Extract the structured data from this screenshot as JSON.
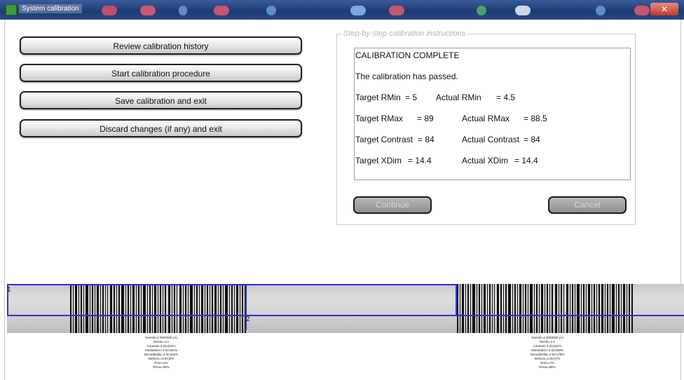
{
  "window": {
    "title": "System calibration",
    "close_glyph": "✕"
  },
  "buttons": [
    {
      "label": "Review calibration history"
    },
    {
      "label": "Start calibration procedure"
    },
    {
      "label": "Save calibration and exit"
    },
    {
      "label": "Discard changes (if any) and exit"
    }
  ],
  "instructions": {
    "group_label": "Step-by-step calibration instructions",
    "heading": "CALIBRATION COMPLETE",
    "status": "The calibration has passed.",
    "rmin": {
      "target_label": "Target RMin",
      "target_value": "= 5",
      "actual_label": "Actual RMin",
      "actual_value": "= 4.5"
    },
    "rmax": {
      "target_label": "Target RMax",
      "target_value": "= 89",
      "actual_label": "Actual RMax",
      "actual_value": "= 88.5"
    },
    "contrast": {
      "target_label": "Target Contrast",
      "target_value": "= 84",
      "actual_label": "Actual Contrast",
      "actual_value": "= 84"
    },
    "xdim": {
      "target_label": "Target XDim",
      "target_value": "= 14.4",
      "actual_label": "Actual XDim",
      "actual_value": "= 14.4"
    },
    "continue_label": "Continue",
    "cancel_label": "Cancel"
  },
  "scan": {
    "marker1": "1",
    "marker2": "2",
    "left_stats": [
      "Overall=4.0000000 (A)",
      "EDGE=4.4",
      "Contrast=4.0(A)84%",
      "Modulation=4.0(A)91%",
      "Decodability=4.0(A)91%",
      "Defects=4.0(A)8%",
      "Rmin=5%",
      "Rmax=89%"
    ],
    "right_stats": [
      "Overall=4.0000000 (A)",
      "EDGE=4.4",
      "Contrast=4.0(A)84%",
      "Modulation=4.0(A)88%",
      "Decodability=4.0(A)79%",
      "Defects=4.0(A)7%",
      "Rmin=4%",
      "Rmax=88%"
    ]
  }
}
